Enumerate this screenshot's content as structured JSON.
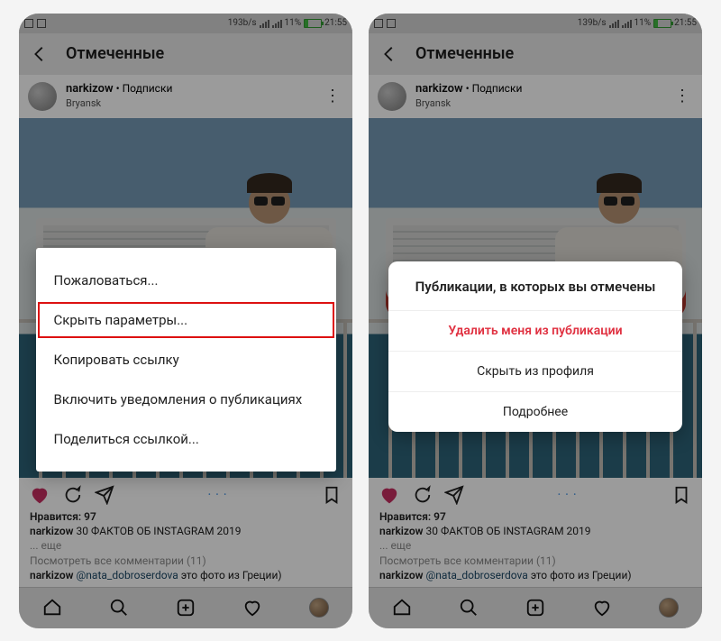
{
  "statusbar": {
    "speed_a": "193b/s",
    "speed_b": "139b/s",
    "battery_pct": "11%",
    "time": "21:55"
  },
  "header": {
    "title": "Отмеченные"
  },
  "post": {
    "username": "narkizow",
    "follow_status": "Подписки",
    "location": "Bryansk"
  },
  "menu_left": {
    "items": [
      "Пожаловаться...",
      "Скрыть параметры...",
      "Копировать ссылку",
      "Включить уведомления о публикациях",
      "Поделиться ссылкой..."
    ],
    "highlight_index": 1
  },
  "dialog_right": {
    "title": "Публикации, в которых вы отмечены",
    "options": [
      {
        "label": "Удалить меня из публикации",
        "danger": true
      },
      {
        "label": "Скрыть из профиля",
        "danger": false
      },
      {
        "label": "Подробнее",
        "danger": false
      }
    ]
  },
  "engagement": {
    "likes_label": "Нравится:",
    "likes_count": "97",
    "caption_text": "30 ФАКТОВ ОБ INSTAGRAM 2019",
    "more_label": "... еще",
    "view_all_prefix": "Посмотреть все комментарии",
    "view_all_count": "(11)",
    "comment_user": "narkizow",
    "comment_mention": "@nata_dobroserdova",
    "comment_tail": "это фото из Греции)"
  }
}
